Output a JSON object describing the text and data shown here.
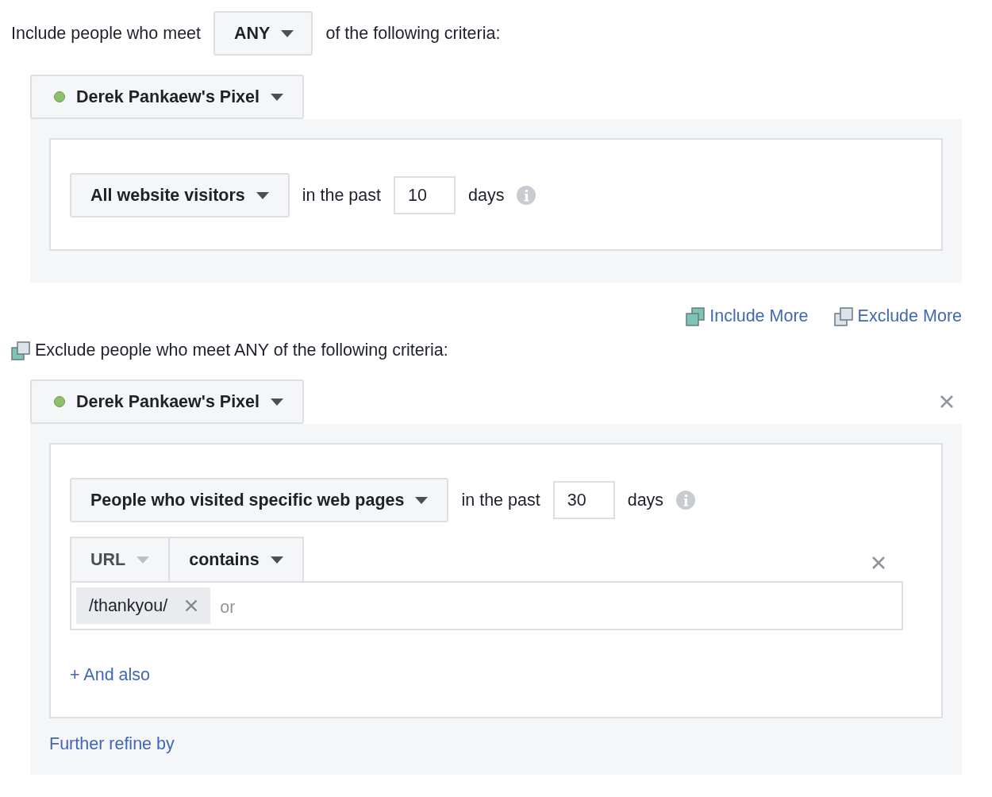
{
  "include": {
    "prefix": "Include people who meet",
    "match": "ANY",
    "suffix": "of the following criteria:",
    "pixel": {
      "name": "Derek Pankaew's Pixel",
      "color": "#8cc06a"
    },
    "audience": "All website visitors",
    "past_label": "in the past",
    "days_value": "10",
    "days_label": "days"
  },
  "actions": [
    {
      "label": "Include More",
      "kind": "include"
    },
    {
      "label": "Exclude More",
      "kind": "exclude"
    }
  ],
  "exclude": {
    "heading": "Exclude people who meet ANY of the following criteria:",
    "pixel": {
      "name": "Derek Pankaew's Pixel",
      "color": "#8cc06a"
    },
    "audience": "People who visited specific web pages",
    "past_label": "in the past",
    "days_value": "30",
    "days_label": "days",
    "filter": {
      "field": {
        "label": "URL",
        "disabled": true
      },
      "operator": "contains",
      "tags": [
        "/thankyou/"
      ],
      "placeholder": "or"
    },
    "and_also": "+ And also",
    "refine": "Further refine by"
  }
}
